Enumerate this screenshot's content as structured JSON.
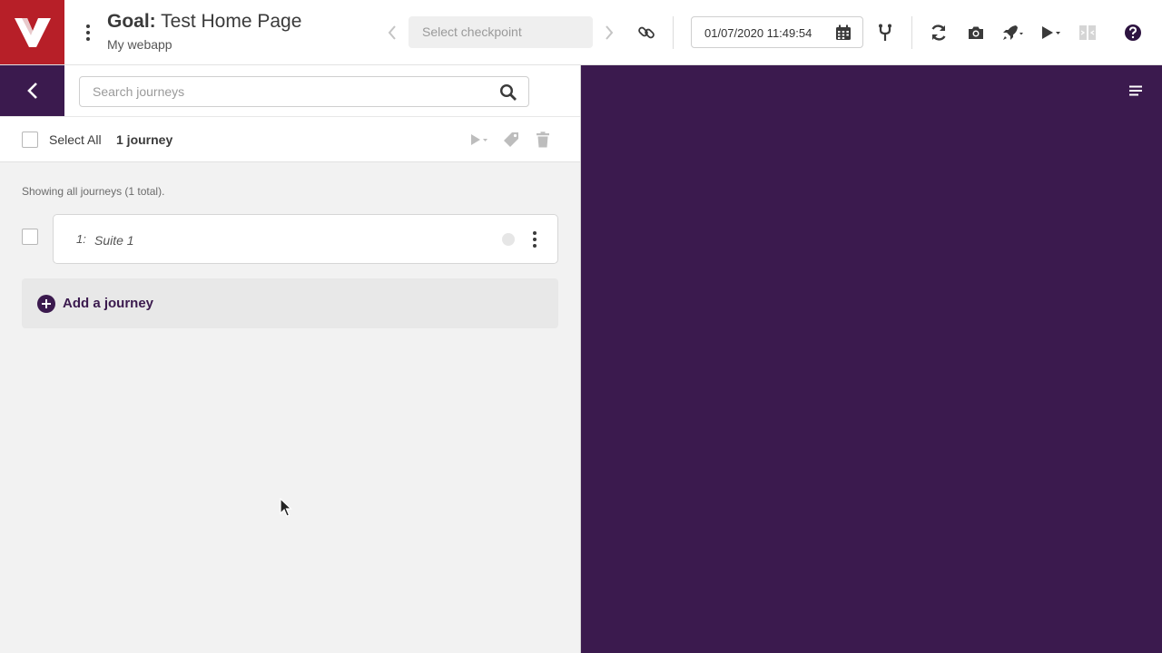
{
  "header": {
    "goal_label": "Goal:",
    "goal_title": "Test Home Page",
    "app_name": "My webapp",
    "checkpoint_placeholder": "Select checkpoint",
    "datetime_value": "01/07/2020 11:49:54"
  },
  "search": {
    "placeholder": "Search journeys"
  },
  "selection_bar": {
    "select_all_label": "Select All",
    "journey_count": "1 journey"
  },
  "main": {
    "showing_text": "Showing all journeys (1 total).",
    "journeys": [
      {
        "number": "1:",
        "name": "Suite 1"
      }
    ],
    "add_journey_label": "Add a journey"
  },
  "colors": {
    "brand_red": "#b71f28",
    "brand_purple": "#3b1a4e"
  }
}
